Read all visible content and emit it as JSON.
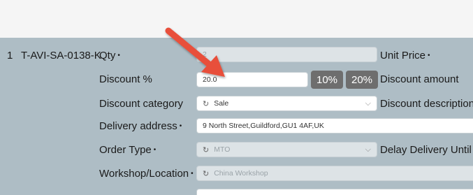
{
  "row": {
    "index": "1",
    "sku": "T-AVI-SA-0138-K"
  },
  "labels": {
    "qty": "Qty",
    "unit_price": "Unit Price",
    "discount_pct": "Discount %",
    "discount_amount": "Discount amount",
    "discount_category": "Discount category",
    "discount_description": "Discount description",
    "delivery_address": "Delivery address",
    "order_type": "Order Type",
    "delay_delivery": "Delay Delivery Until",
    "workshop_location": "Workshop/Location",
    "required_marker": "•"
  },
  "fields": {
    "qty_value": "2",
    "discount_pct_value": "20.0",
    "discount_category_value": "Sale",
    "delivery_address_value": "9 North Street,Guildford,GU1 4AF,UK",
    "order_type_value": "MTO",
    "workshop_value": "China Workshop"
  },
  "buttons": {
    "ten_pct": "10%",
    "twenty_pct": "20%"
  },
  "icons": {
    "refresh": "refresh-icon",
    "chevron": "chevron-down-icon",
    "annotation": "red-arrow"
  },
  "colors": {
    "panel": "#aebdc5",
    "button": "#6e6e6e",
    "arrow": "#e8503a"
  }
}
